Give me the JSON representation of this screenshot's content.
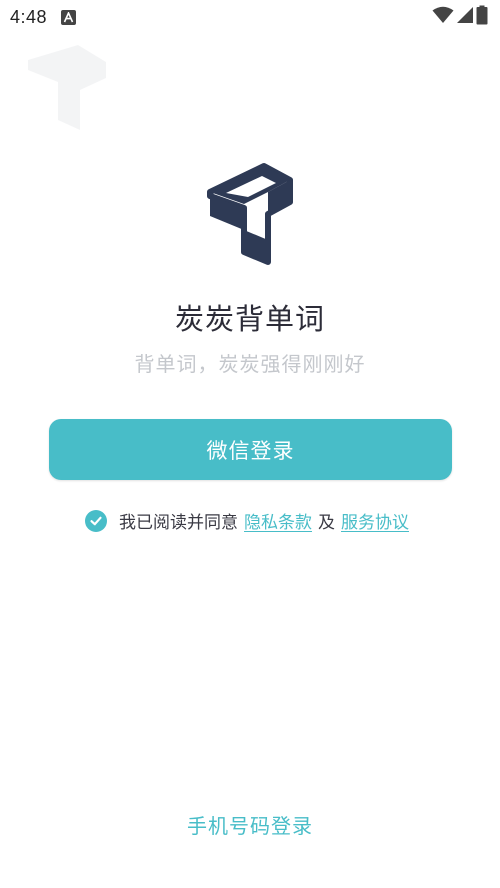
{
  "status_bar": {
    "time": "4:48",
    "notification_icon": "a-launcher-icon",
    "wifi_icon": "wifi-icon",
    "signal_icon": "signal-icon",
    "battery_icon": "battery-icon"
  },
  "logo": {
    "icon": "t-block-logo-icon",
    "color_dark": "#2e3a55"
  },
  "app": {
    "name": "炭炭背单词",
    "slogan": "背单词，炭炭强得刚刚好"
  },
  "login": {
    "wechat_label": "微信登录",
    "phone_label": "手机号码登录"
  },
  "agreement": {
    "checked": true,
    "prefix": "我已阅读并同意",
    "privacy_link": "隐私条款",
    "and": "及",
    "service_link": "服务协议"
  },
  "colors": {
    "accent": "#48bdc8",
    "text_dark": "#2c2c38",
    "text_light": "#c4c7cc"
  }
}
